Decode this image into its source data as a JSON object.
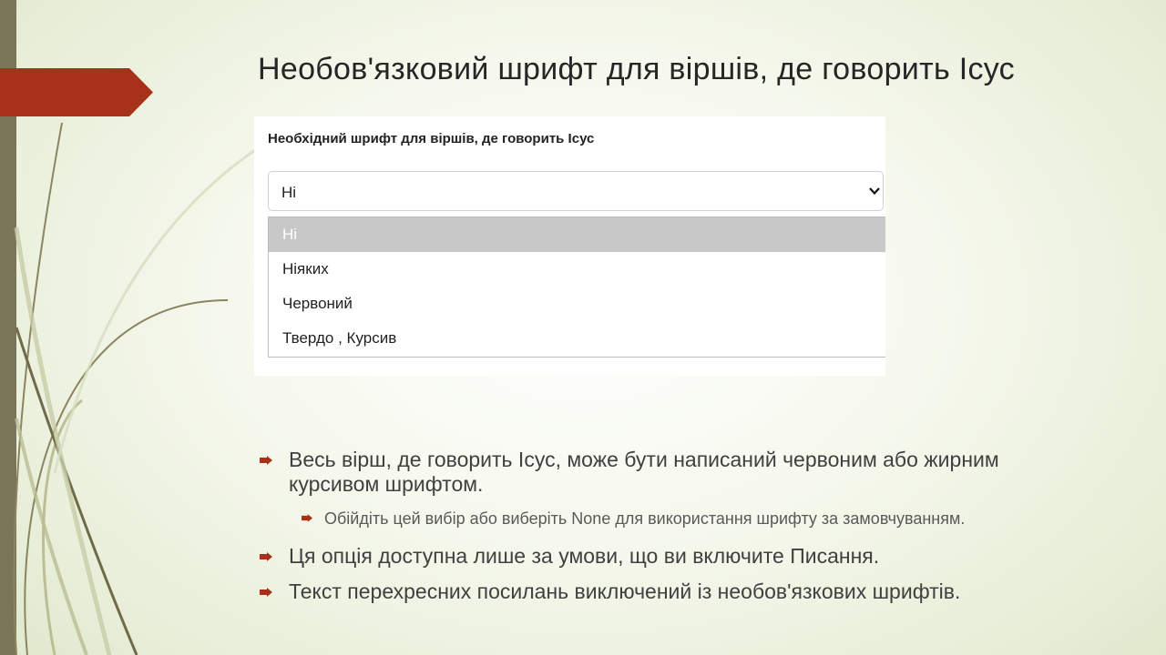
{
  "slide": {
    "title": "Необов'язковий шрифт для віршів, де говорить Ісус"
  },
  "screenshot": {
    "label": "Необхідний шрифт для віршів, де говорить Ісус",
    "select": {
      "value": "Ні",
      "options": [
        "Ні",
        "Ніяких",
        "Червоний",
        "Твердо , Курсив"
      ],
      "selected_index": 0
    }
  },
  "bullets": [
    {
      "level": 1,
      "text": "Весь вірш, де говорить Ісус, може бути написаний червоним або жирним курсивом шрифтом."
    },
    {
      "level": 2,
      "text": "Обійдіть цей вибір або виберіть None для використання шрифту за замовчуванням."
    },
    {
      "level": 1,
      "text": "Ця опція доступна лише за умови, що ви включите Писання."
    },
    {
      "level": 1,
      "text": "Текст перехресних посилань виключений із необов'язкових шрифтів."
    }
  ],
  "colors": {
    "accent": "#a8311a",
    "side_bar": "#7a7459",
    "selected_option": "#c8c8c8"
  },
  "icons": [
    "arrow-bullet-icon",
    "chevron-down-icon"
  ]
}
